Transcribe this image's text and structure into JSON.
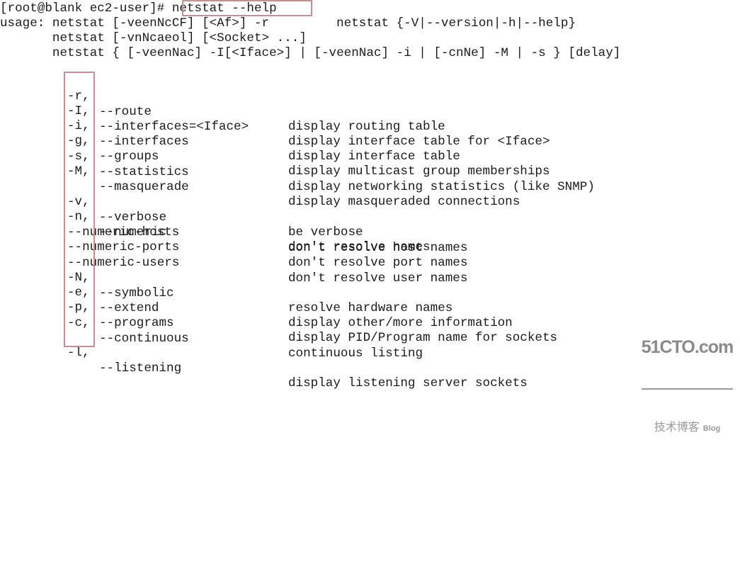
{
  "terminal": {
    "prompt": "[root@blank ec2-user]# ",
    "command": "netstat --help",
    "usage_lines": [
      "usage: netstat [-veenNcCF] [<Af>] -r         netstat {-V|--version|-h|--help}",
      "       netstat [-vnNcaeol] [<Socket> ...]",
      "       netstat { [-veenNac] -I[<Iface>] | [-veenNac] -i | [-cnNe] -M | -s } [delay]"
    ],
    "options_group_1": [
      {
        "short": "-r,",
        "long": "--route",
        "desc": "display routing table"
      },
      {
        "short": "-I,",
        "long": "--interfaces=<Iface>",
        "desc": "display interface table for <Iface>"
      },
      {
        "short": "-i,",
        "long": "--interfaces",
        "desc": "display interface table"
      },
      {
        "short": "-g,",
        "long": "--groups",
        "desc": "display multicast group memberships"
      },
      {
        "short": "-s,",
        "long": "--statistics",
        "desc": "display networking statistics (like SNMP)"
      },
      {
        "short": "-M,",
        "long": "--masquerade",
        "desc": "display masqueraded connections"
      }
    ],
    "options_group_2": [
      {
        "short": "-v,",
        "long": "--verbose",
        "desc": "be verbose"
      },
      {
        "short": "-n,",
        "long": "--numeric",
        "desc": "don't resolve names"
      },
      {
        "short": "",
        "long": "--numeric-hosts",
        "desc": "don't resolve host names"
      },
      {
        "short": "",
        "long": "--numeric-ports",
        "desc": "don't resolve port names"
      },
      {
        "short": "",
        "long": "--numeric-users",
        "desc": "don't resolve user names"
      },
      {
        "short": "-N,",
        "long": "--symbolic",
        "desc": "resolve hardware names"
      },
      {
        "short": "-e,",
        "long": "--extend",
        "desc": "display other/more information"
      },
      {
        "short": "-p,",
        "long": "--programs",
        "desc": "display PID/Program name for sockets"
      },
      {
        "short": "-c,",
        "long": "--continuous",
        "desc": "continuous listing"
      }
    ],
    "options_group_3": [
      {
        "short": "-l,",
        "long": "--listening",
        "desc": "display listening server sockets"
      }
    ],
    "highlight_color": "#c98e8e",
    "text_color": "#1b1b1b",
    "background_color": "#ffffff"
  },
  "watermark": {
    "main": "51CTO.com",
    "sub": "技术博客",
    "blog": "Blog"
  }
}
